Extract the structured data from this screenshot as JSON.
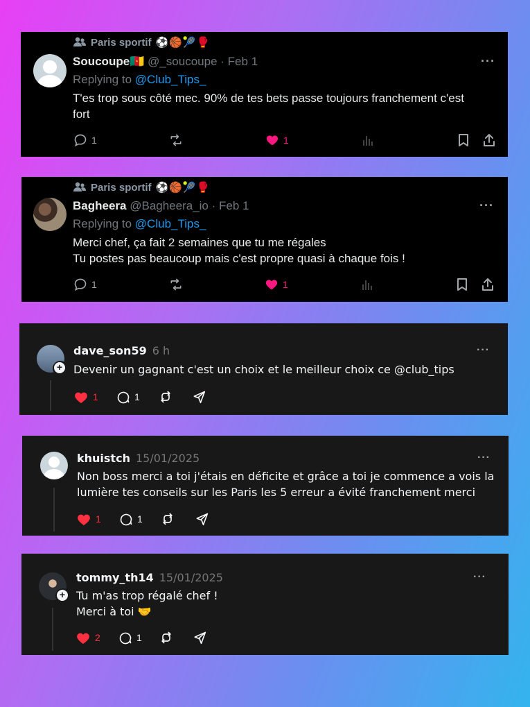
{
  "tweets": [
    {
      "community": "Paris sportif",
      "community_emojis": "⚽🏀🎾🥊",
      "name": "Soucoupe",
      "name_flag": "🇨🇲",
      "handle": "@_soucoupe",
      "sep": "·",
      "date": "Feb 1",
      "replying_label": "Replying to",
      "replying_to": "@Club_Tips_",
      "text_lines": [
        "T'es trop sous côté mec. 90% de tes bets passe toujours franchement c'est",
        "fort"
      ],
      "replies": "1",
      "likes": "1"
    },
    {
      "community": "Paris sportif",
      "community_emojis": "⚽🏀🎾🥊",
      "name": "Bagheera",
      "handle": "@Bagheera_io",
      "sep": "·",
      "date": "Feb 1",
      "replying_label": "Replying to",
      "replying_to": "@Club_Tips_",
      "text_lines": [
        "Merci chef, ça fait 2 semaines que tu me régales",
        "Tu postes pas beaucoup mais c'est propre quasi à chaque fois !"
      ],
      "replies": "1",
      "likes": "1"
    }
  ],
  "threads": [
    {
      "username": "dave_son59",
      "time": "6 h",
      "text_lines": [
        "Devenir un gagnant c'est un choix et le meilleur choix ce @club_tips"
      ],
      "likes": "1",
      "replies": "1"
    },
    {
      "username": "khuistch",
      "time": "15/01/2025",
      "text_lines": [
        "Non boss merci a toi j'étais en déficite et grâce a toi je commence a vois la",
        "lumière tes conseils sur les Paris les 5 erreur a évité franchement merci"
      ],
      "likes": "1",
      "replies": "1"
    },
    {
      "username": "tommy_th14",
      "time": "15/01/2025",
      "text_lines": [
        "Tu m'as trop régalé chef !",
        "Merci à toi 🤝"
      ],
      "likes": "2",
      "replies": "1"
    }
  ],
  "icons": {
    "more": "···"
  },
  "colors": {
    "like_pink": "#f91880",
    "like_red": "#ff3040",
    "link_blue": "#1d9bf0"
  }
}
